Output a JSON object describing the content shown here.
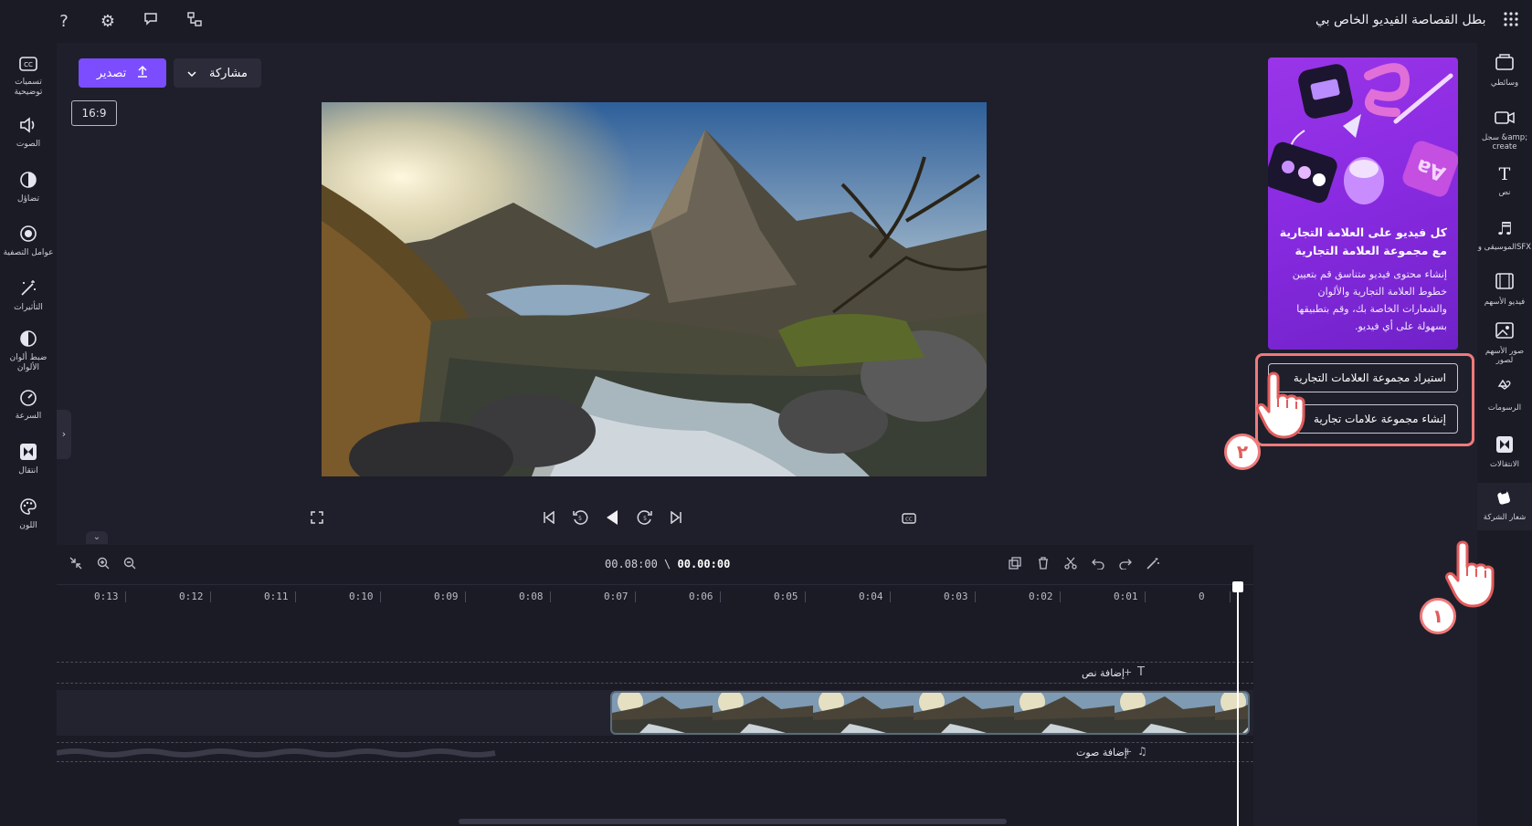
{
  "topbar": {
    "brand": "بطل القصاصة",
    "project": "الفيديو الخاص بي",
    "icons": [
      "apps-grid-icon",
      "help-icon",
      "settings-icon",
      "feedback-icon",
      "share-network-icon"
    ]
  },
  "left_rail": {
    "items": [
      {
        "label": "تسميات توضيحية",
        "icon": "captions-icon"
      },
      {
        "label": "الصوت",
        "icon": "audio-icon"
      },
      {
        "label": "تضاؤل",
        "icon": "fade-icon"
      },
      {
        "label": "عوامل التصفية",
        "icon": "filters-icon"
      },
      {
        "label": "التأثيرات",
        "icon": "effects-icon"
      },
      {
        "label": "ضبط ألوان الألوان",
        "icon": "color-adjust-icon"
      },
      {
        "label": "السرعة",
        "icon": "speed-icon"
      },
      {
        "label": "انتقال",
        "icon": "transition-icon"
      },
      {
        "label": "اللون",
        "icon": "palette-icon"
      }
    ]
  },
  "right_rail": {
    "items": [
      {
        "label": "وسائطي",
        "icon": "media-icon"
      },
      {
        "label": "سجل &amp; create",
        "icon": "record-icon"
      },
      {
        "label": "نص",
        "icon": "text-icon"
      },
      {
        "label": "الموسيقى وSFX",
        "icon": "music-icon"
      },
      {
        "label": "فيديو الأسهم",
        "icon": "stock-video-icon"
      },
      {
        "label": "صور الأسهم لصور",
        "icon": "stock-image-icon"
      },
      {
        "label": "الرسومات",
        "icon": "graphics-icon"
      },
      {
        "label": "الانتقالات",
        "icon": "transitions-icon"
      },
      {
        "label": "شعار الشركة",
        "icon": "brand-kit-icon"
      }
    ]
  },
  "stage": {
    "export_label": "تصدير",
    "share_label": "مشاركة",
    "aspect_ratio": "16:9"
  },
  "timeline": {
    "current_time": "00.00:00",
    "total_time": "00.08:00",
    "separator": "\\",
    "ticks": [
      "0",
      "0:01",
      "0:02",
      "0:03",
      "0:04",
      "0:05",
      "0:06",
      "0:07",
      "0:08",
      "0:09",
      "0:10",
      "0:11",
      "0:12",
      "0:13"
    ],
    "add_text": "إضافة نص",
    "add_audio": "إضافة صوت"
  },
  "brand_panel": {
    "promo_title": "كل فيديو على العلامة التجارية مع مجموعة العلامة التجارية",
    "promo_body": "إنشاء محتوى فيديو متناسق قم بتعيين خطوط العلامة التجارية والألوان والشعارات الخاصة بك، وقم بتطبيقها بسهولة على أي فيديو.",
    "import_button": "استيراد مجموعة العلامات التجارية",
    "create_button": "إنشاء مجموعة علامات تجارية"
  },
  "annotations": {
    "step1": "١",
    "step2": "٢"
  },
  "colors": {
    "accent": "#7c4dff",
    "highlight": "#f07a7a",
    "background": "#1b1b26"
  }
}
